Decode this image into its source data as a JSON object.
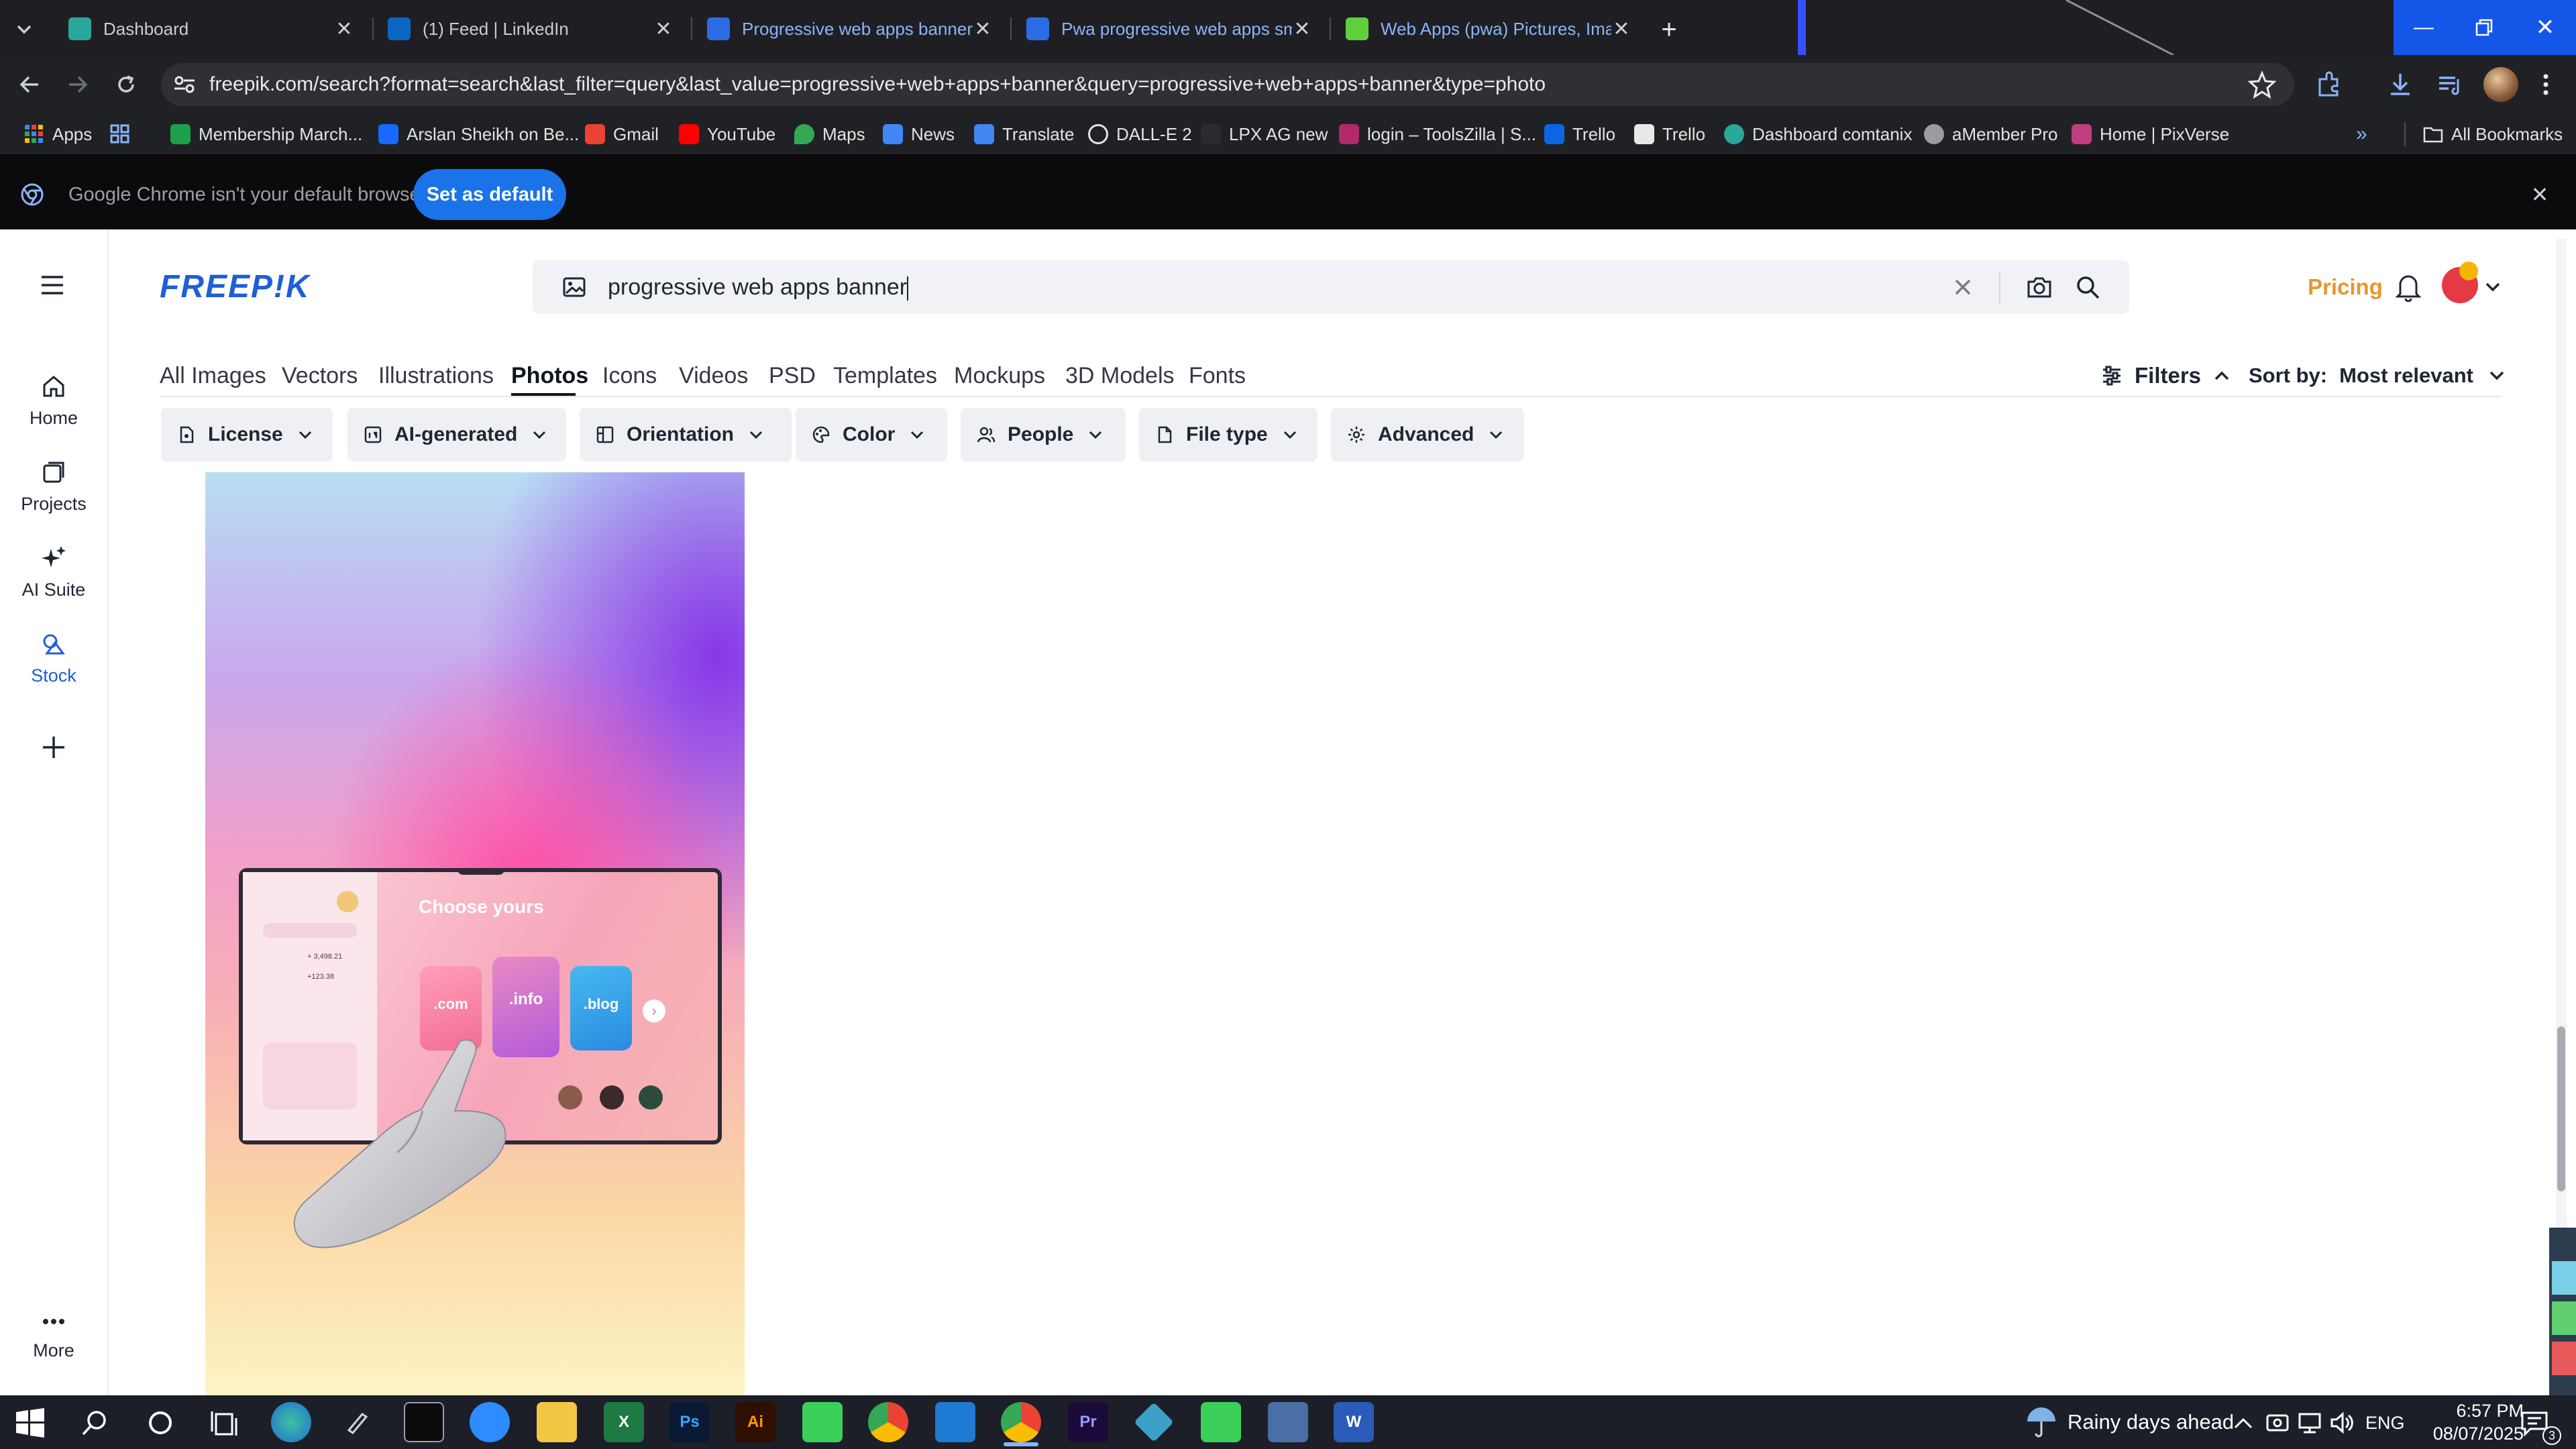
{
  "tabs": [
    {
      "title": "Dashboard",
      "color": "#2aa79b"
    },
    {
      "title": "(1) Feed | LinkedIn",
      "color": "#0a66c2"
    },
    {
      "title": "Progressive web apps banner P",
      "color": "#2b6be4"
    },
    {
      "title": "Pwa progressive web apps sma",
      "color": "#2b6be4"
    },
    {
      "title": "Web Apps (pwa) Pictures, Imag",
      "color": "#5fcf3c"
    }
  ],
  "url": "freepik.com/search?format=search&last_filter=query&last_value=progressive+web+apps+banner&query=progressive+web+apps+banner&type=photo",
  "bookmarks": [
    {
      "label": "Apps"
    },
    {
      "label": "Membership March..."
    },
    {
      "label": "Arslan Sheikh on Be..."
    },
    {
      "label": "Gmail"
    },
    {
      "label": "YouTube"
    },
    {
      "label": "Maps"
    },
    {
      "label": "News"
    },
    {
      "label": "Translate"
    },
    {
      "label": "DALL-E 2"
    },
    {
      "label": "LPX AG new"
    },
    {
      "label": "login – ToolsZilla | S..."
    },
    {
      "label": "Trello"
    },
    {
      "label": "Trello"
    },
    {
      "label": "Dashboard comtanix"
    },
    {
      "label": "aMember Pro"
    },
    {
      "label": "Home | PixVerse"
    }
  ],
  "all_bookmarks": "All Bookmarks",
  "infobar": {
    "message": "Google Chrome isn't your default browser",
    "button": "Set as default"
  },
  "logo": "FREEP!K",
  "search": {
    "value": "progressive web apps banner"
  },
  "pricing": "Pricing",
  "nav": {
    "home": "Home",
    "projects": "Projects",
    "ai_suite": "AI Suite",
    "stock": "Stock",
    "more": "More"
  },
  "type_tabs": [
    "All Images",
    "Vectors",
    "Illustrations",
    "Photos",
    "Icons",
    "Videos",
    "PSD",
    "Templates",
    "Mockups",
    "3D Models",
    "Fonts"
  ],
  "filters_label": "Filters",
  "sort": {
    "label": "Sort by:",
    "value": "Most relevant"
  },
  "chips": [
    "License",
    "AI-generated",
    "Orientation",
    "Color",
    "People",
    "File type",
    "Advanced"
  ],
  "image": {
    "heading": "Choose yours",
    "stat1": "+ 3,498.21",
    "stat2": "+123.38",
    "cards": [
      ".com",
      ".info",
      ".blog"
    ]
  },
  "taskbar": {
    "weather": "Rainy days ahead",
    "lang": "ENG",
    "time": "6:57 PM",
    "date": "08/07/2025",
    "notif": "3"
  }
}
